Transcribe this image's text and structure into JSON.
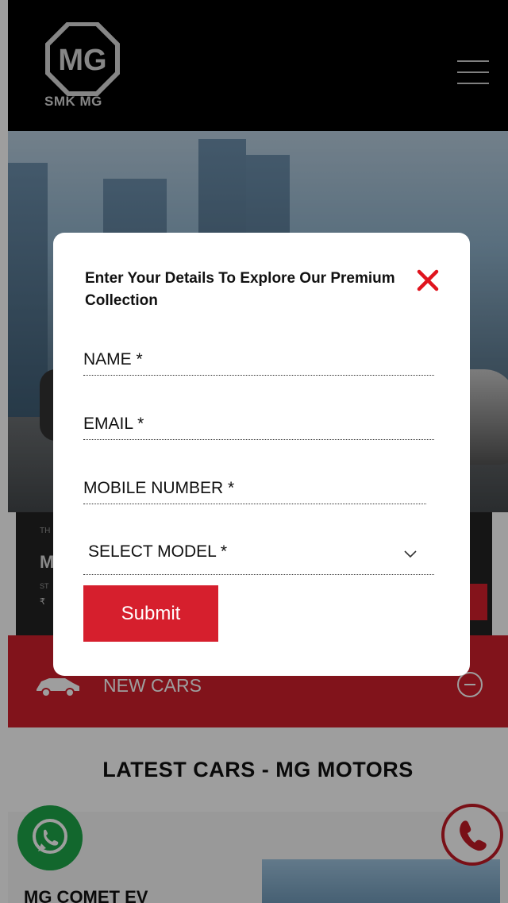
{
  "header": {
    "brand_name": "SMK MG",
    "logo_icon": "mg-logo-icon",
    "menu_icon": "hamburger-menu-icon"
  },
  "nav_bar": {
    "label": "NEW CARS",
    "icon": "car-icon",
    "toggle_icon": "minus-circle-icon"
  },
  "latest_section": {
    "title": "LATEST CARS - MG MOTORS",
    "first_car_name": "MG COMET EV"
  },
  "floating": {
    "whatsapp_icon": "whatsapp-icon",
    "phone_icon": "phone-icon"
  },
  "modal": {
    "title": "Enter Your Details To Explore Our Premium Collection",
    "close_icon": "close-icon",
    "name_placeholder": "NAME *",
    "email_placeholder": "EMAIL *",
    "mobile_placeholder": "MOBILE NUMBER *",
    "model_select_label": "SELECT MODEL *",
    "submit_label": "Submit"
  },
  "colors": {
    "brand_red": "#d61f2d",
    "whatsapp_green": "#1ea64a",
    "header_black": "#000000"
  }
}
